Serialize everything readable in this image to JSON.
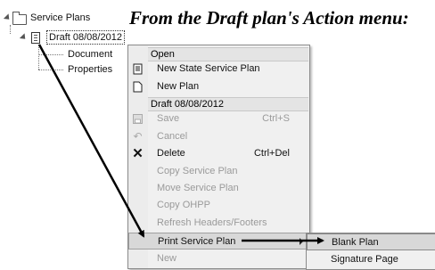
{
  "heading": "From the Draft plan's Action menu:",
  "tree": {
    "root_label": "Service Plans",
    "draft_label": "Draft 08/08/2012",
    "children": [
      "Document",
      "Properties"
    ]
  },
  "menu": {
    "section_open": "Open",
    "new_state_plan": "New State Service Plan",
    "new_plan": "New Plan",
    "section_draft": "Draft 08/08/2012",
    "save": "Save",
    "save_shortcut": "Ctrl+S",
    "cancel": "Cancel",
    "delete": "Delete",
    "delete_shortcut": "Ctrl+Del",
    "copy_plan": "Copy Service Plan",
    "move_plan": "Move Service Plan",
    "copy_ohpp": "Copy OHPP",
    "refresh": "Refresh Headers/Footers",
    "print_plan": "Print Service Plan",
    "new_partial": "New"
  },
  "submenu": {
    "blank_plan": "Blank Plan",
    "signature_page": "Signature Page"
  },
  "icons": {
    "expander": "expand-arrow-icon",
    "folder": "folder-icon",
    "document": "document-icon",
    "new_plan": "new-document-icon",
    "save": "save-icon",
    "cancel": "undo-icon",
    "delete": "delete-x-icon",
    "submenu": "submenu-arrow-icon"
  }
}
